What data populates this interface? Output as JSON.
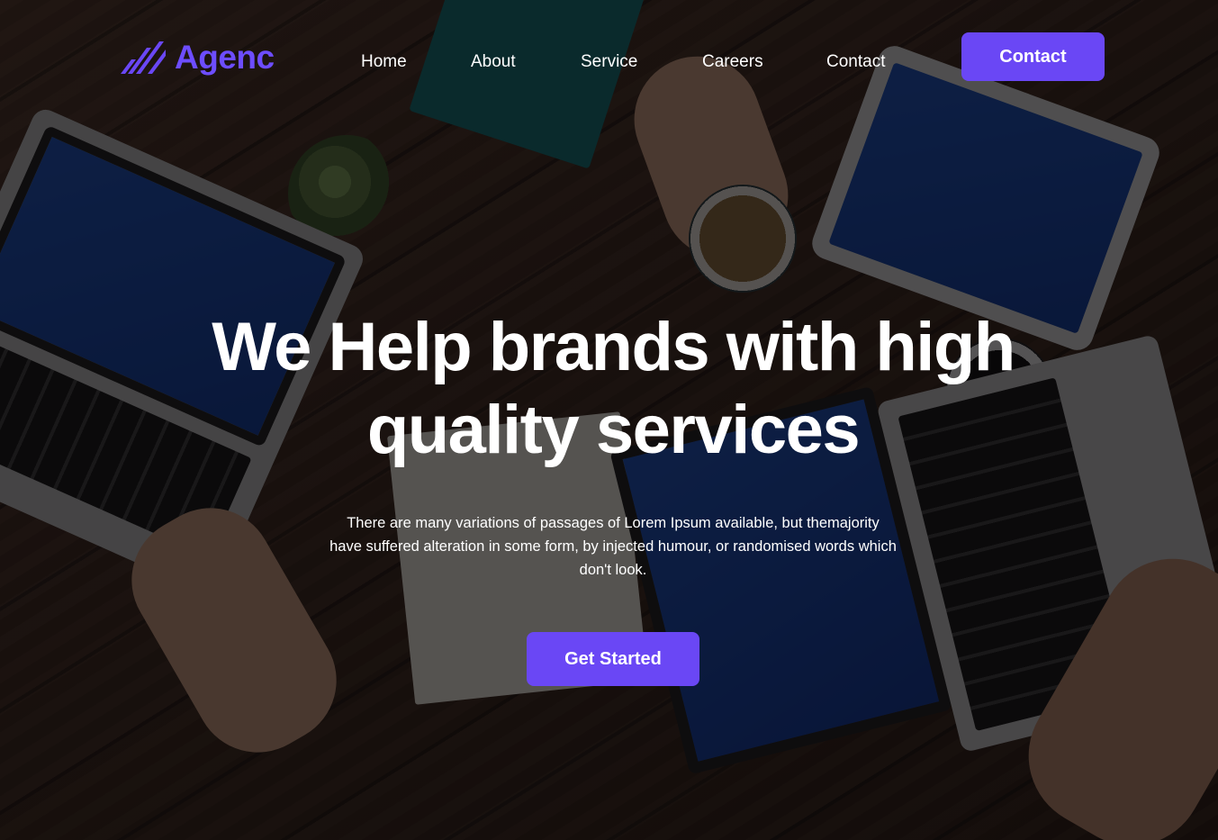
{
  "brand": {
    "name": "Agenc",
    "accent_color": "#6a47f5",
    "logo_icon": "slash-stripes-icon"
  },
  "nav": {
    "items": [
      {
        "label": "Home"
      },
      {
        "label": "About"
      },
      {
        "label": "Service"
      },
      {
        "label": "Careers"
      },
      {
        "label": "Contact"
      }
    ],
    "cta_label": "Contact"
  },
  "hero": {
    "title": "We Help brands with high quality services",
    "description": "There are many variations of passages of Lorem Ipsum available, but themajority have suffered alteration in some form, by injected humour, or randomised words which don't look.",
    "cta_label": "Get Started"
  }
}
